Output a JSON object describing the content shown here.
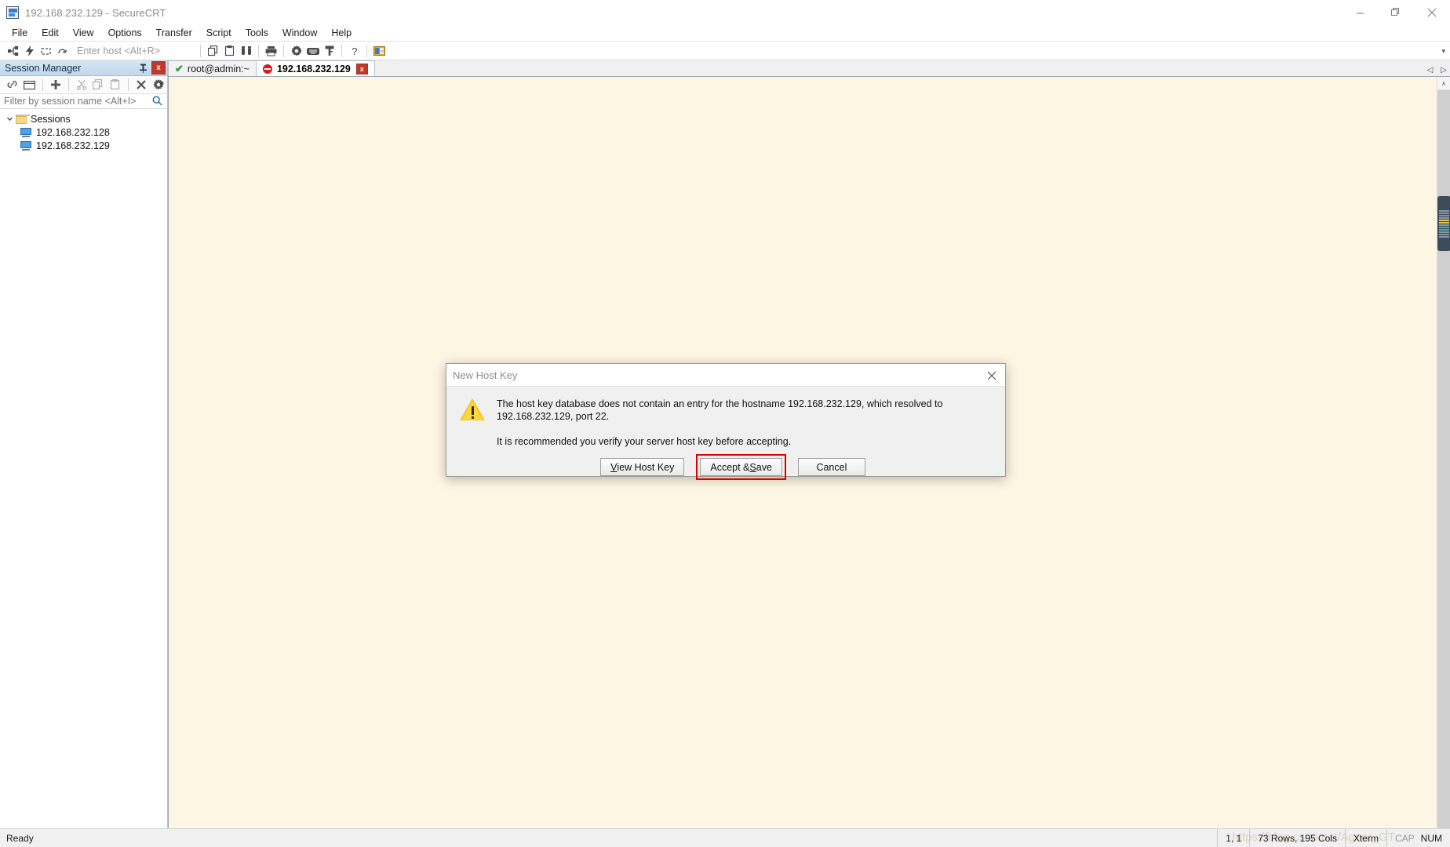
{
  "window": {
    "title": "192.168.232.129 - SecureCRT",
    "app_icon": "securecrt-icon",
    "minimize_label": "Minimize",
    "restore_label": "Restore",
    "close_label": "Close"
  },
  "menubar": {
    "items": [
      {
        "label": "File"
      },
      {
        "label": "Edit"
      },
      {
        "label": "View"
      },
      {
        "label": "Options"
      },
      {
        "label": "Transfer"
      },
      {
        "label": "Script"
      },
      {
        "label": "Tools"
      },
      {
        "label": "Window"
      },
      {
        "label": "Help"
      }
    ]
  },
  "toolbar": {
    "host_placeholder": "Enter host <Alt+R>",
    "host_value": "",
    "icons": [
      "connect-icon",
      "quick-connect-icon",
      "connect-in-tab-icon",
      "reconnect-icon",
      "copy-icon",
      "paste-icon",
      "find-icon",
      "print-icon",
      "session-options-icon",
      "keymap-editor-icon",
      "key-icon",
      "help-icon",
      "arrange-icon"
    ],
    "overflow_label": "More toolbar buttons"
  },
  "session_manager": {
    "title": "Session Manager",
    "pin_label": "Auto Hide",
    "close_label": "x",
    "toolbar_icons": [
      "connect-link-icon",
      "new-session-window-icon",
      "new-session-icon",
      "cut-icon",
      "copy-icon",
      "paste-icon",
      "delete-icon",
      "properties-gear-icon"
    ],
    "overflow_label": "»",
    "filter": {
      "placeholder": "Filter by session name <Alt+I>",
      "value": "",
      "search_icon": "search-icon"
    },
    "tree": {
      "root": {
        "label": "Sessions",
        "icon": "folder-icon",
        "expanded": true
      },
      "children": [
        {
          "label": "192.168.232.128",
          "icon": "computer-icon"
        },
        {
          "label": "192.168.232.129",
          "icon": "computer-icon"
        }
      ]
    }
  },
  "tabs": {
    "items": [
      {
        "label": "root@admin:~",
        "status_icon": "green-check-icon",
        "active": false,
        "closable": false
      },
      {
        "label": "192.168.232.129",
        "status_icon": "red-disconnected-icon",
        "active": true,
        "closable": true,
        "close_label": "x"
      }
    ],
    "nav_prev": "◁",
    "nav_next": "▷"
  },
  "terminal": {
    "background_color": "#fdf6e3",
    "content": "",
    "scroll_up_glyph": "∧"
  },
  "dialog": {
    "title": "New Host Key",
    "close_label": "✕",
    "icon": "warning-icon",
    "message_1": "The host key database does not contain an entry for the hostname 192.168.232.129, which resolved to 192.168.232.129, port 22.",
    "message_2": "It is recommended you verify your server host key before accepting.",
    "buttons": [
      {
        "id": "view-host-key",
        "prefix": "",
        "accel": "V",
        "suffix": "iew Host Key",
        "highlighted": false
      },
      {
        "id": "accept-save",
        "prefix": "Accept & ",
        "accel": "S",
        "suffix": "ave",
        "highlighted": true
      },
      {
        "id": "cancel",
        "prefix": "Cancel",
        "accel": "",
        "suffix": "",
        "highlighted": false
      }
    ],
    "highlight_color": "#e00000"
  },
  "statusbar": {
    "ready_text": "Ready",
    "cursor_position": "1,  1",
    "dimensions": "73 Rows, 195 Cols",
    "emulation": "Xterm",
    "cap_indicator": "CAP",
    "num_indicator": "NUM",
    "watermark": "https://blog.csdn.net/Agner_GT"
  }
}
